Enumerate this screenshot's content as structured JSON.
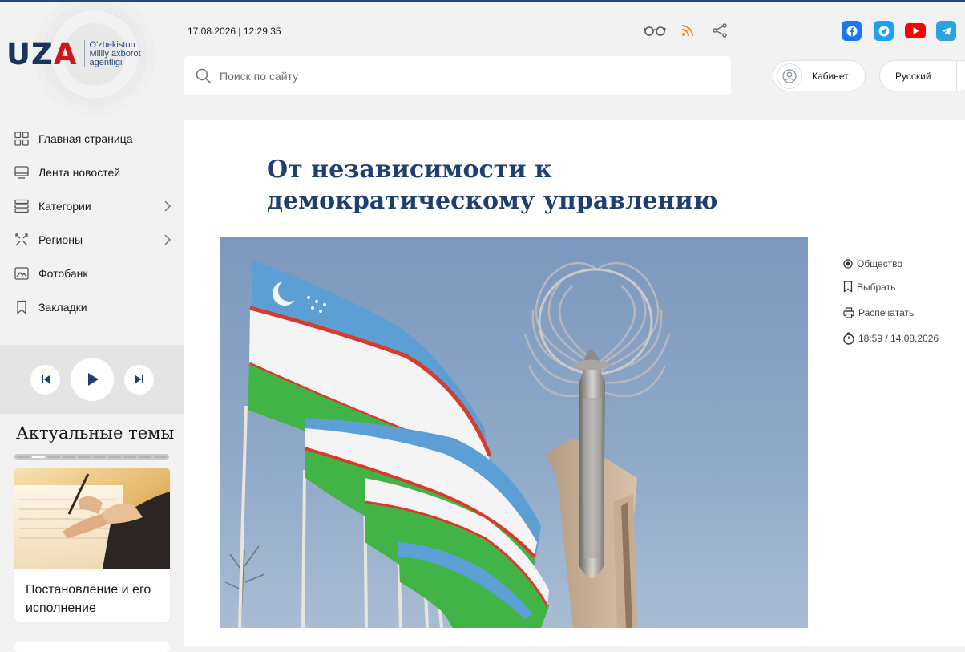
{
  "logo": {
    "mark": "UZA",
    "text_line1": "O'zbekiston",
    "text_line2": "Milliy axborot",
    "text_line3": "agentligi"
  },
  "header": {
    "datetime": "17.08.2026 | 12:29:35",
    "search_placeholder": "Поиск по сайту",
    "cabinet_label": "Кабинет",
    "language_label": "Русский"
  },
  "sidebar": {
    "items": [
      {
        "label": "Главная страница",
        "icon": "grid-icon"
      },
      {
        "label": "Лента новостей",
        "icon": "monitor-icon"
      },
      {
        "label": "Категории",
        "icon": "stack-icon"
      },
      {
        "label": "Регионы",
        "icon": "regions-icon"
      },
      {
        "label": "Фотобанк",
        "icon": "image-icon"
      },
      {
        "label": "Закладки",
        "icon": "bookmark-icon"
      }
    ]
  },
  "topics": {
    "title": "Актуальные темы",
    "cards": [
      {
        "title": "Постановление и его исполнение"
      }
    ]
  },
  "article": {
    "title": "От независимости к демократическому управлению",
    "category": "Общество",
    "bookmark_label": "Выбрать",
    "print_label": "Распечатать",
    "published": "18:59 / 14.08.2026"
  },
  "colors": {
    "accent": "#1f3f70",
    "facebook": "#1877f2",
    "twitter": "#1da1f2",
    "youtube": "#ff0000",
    "telegram": "#2aa3e0",
    "rss": "#f28c1a"
  }
}
